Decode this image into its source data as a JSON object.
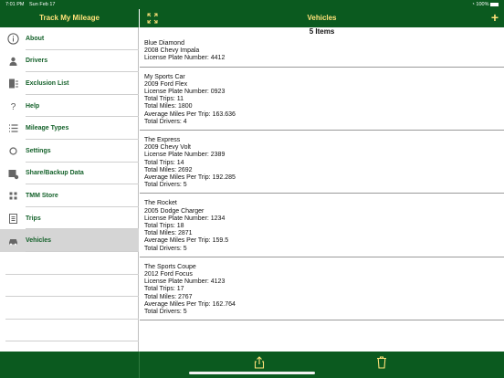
{
  "status": {
    "time": "7:01 PM",
    "date": "Sun Feb 17",
    "battery": "100%"
  },
  "sidebar": {
    "title": "Track My Mileage",
    "items": [
      {
        "label": "About",
        "icon": "info-icon"
      },
      {
        "label": "Drivers",
        "icon": "person-icon"
      },
      {
        "label": "Exclusion List",
        "icon": "exclusion-icon"
      },
      {
        "label": "Help",
        "icon": "question-icon"
      },
      {
        "label": "Mileage Types",
        "icon": "list-icon"
      },
      {
        "label": "Settings",
        "icon": "gear-icon"
      },
      {
        "label": "Share/Backup Data",
        "icon": "share-data-icon"
      },
      {
        "label": "TMM Store",
        "icon": "store-icon"
      },
      {
        "label": "Trips",
        "icon": "trips-icon"
      },
      {
        "label": "Vehicles",
        "icon": "car-icon",
        "active": true
      }
    ]
  },
  "main": {
    "title": "Vehicles",
    "count": "5 Items",
    "vehicles": [
      {
        "lines": [
          "Blue Diamond",
          "2008 Chevy Impala",
          "License Plate Number: 4412"
        ]
      },
      {
        "lines": [
          "My Sports Car",
          "2009 Ford Flex",
          "License Plate Number: 0923",
          "Total Trips: 11",
          "Total Miles: 1800",
          "Average Miles Per Trip: 163.636",
          "Total Drivers: 4"
        ]
      },
      {
        "lines": [
          "The Express",
          "2009 Chevy Volt",
          "License Plate Number: 2389",
          "Total Trips: 14",
          "Total Miles: 2692",
          "Average Miles Per Trip: 192.285",
          "Total Drivers: 5"
        ]
      },
      {
        "lines": [
          "The Rocket",
          "2005 Dodge Charger",
          "License Plate Number: 1234",
          "Total Trips: 18",
          "Total Miles: 2871",
          "Average Miles Per Trip: 159.5",
          "Total Drivers: 5"
        ]
      },
      {
        "lines": [
          "The Sports Coupe",
          "2012 Ford Focus",
          "License Plate Number: 4123",
          "Total Trips: 17",
          "Total Miles: 2767",
          "Average Miles Per Trip: 162.764",
          "Total Drivers: 5"
        ]
      }
    ]
  },
  "toolbar": {
    "share_icon": "share-icon",
    "trash_icon": "trash-icon"
  },
  "colors": {
    "bar": "#0b5a1f",
    "accent": "#ffe27a",
    "label": "#14612a"
  }
}
